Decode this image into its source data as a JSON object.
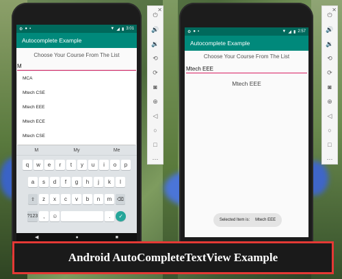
{
  "left_phone": {
    "status": {
      "time": "3:01"
    },
    "app_title": "Autocomplete Example",
    "hint": "Choose Your Course From The List",
    "input_value": "M",
    "dropdown": [
      "MCA",
      "Mtech CSE",
      "Mtech EEE",
      "Mtech ECE",
      "Mtech CSE"
    ],
    "suggestions": [
      "M",
      "My",
      "Me"
    ],
    "keyboard": {
      "row1": [
        "q",
        "w",
        "e",
        "r",
        "t",
        "y",
        "u",
        "i",
        "o",
        "p"
      ],
      "row2": [
        "a",
        "s",
        "d",
        "f",
        "g",
        "h",
        "j",
        "k",
        "l"
      ],
      "row3": [
        "z",
        "x",
        "c",
        "v",
        "b",
        "n",
        "m"
      ],
      "sym_label": "?123",
      "comma": ",",
      "period": "."
    }
  },
  "right_phone": {
    "status": {
      "time": "2:57"
    },
    "app_title": "Autocomplete Example",
    "hint": "Choose Your Course From The List",
    "input_value": "Mtech EEE",
    "result": "Mtech EEE",
    "toast": {
      "label": "Selected Item is:",
      "value": "Mtech EEE"
    }
  },
  "emulator_panel": {
    "icons": [
      "power-icon",
      "volume-up-icon",
      "volume-down-icon",
      "rotate-left-icon",
      "rotate-right-icon",
      "camera-icon",
      "zoom-icon",
      "back-icon",
      "home-icon",
      "overview-icon",
      "more-icon"
    ]
  },
  "caption": "Android AutoCompleteTextView Example",
  "colors": {
    "appbar": "#00897b",
    "statusbar": "#00695c",
    "accent": "#d81b60",
    "caption_border": "#e53935"
  }
}
